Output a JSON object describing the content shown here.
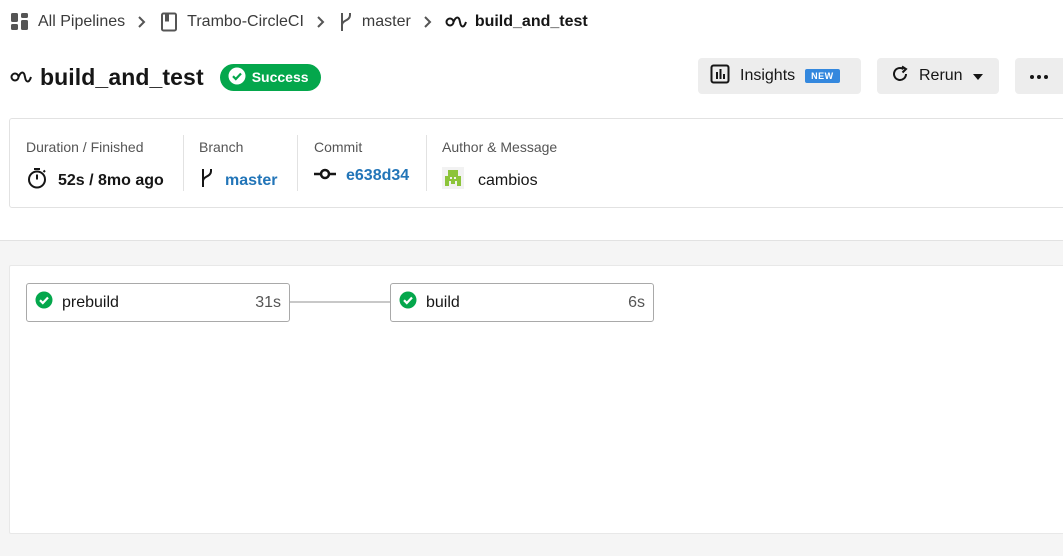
{
  "breadcrumb": {
    "all_pipelines": "All Pipelines",
    "project": "Trambo-CircleCI",
    "branch": "master",
    "workflow": "build_and_test"
  },
  "header": {
    "title": "build_and_test",
    "status": "Success",
    "insights_label": "Insights",
    "insights_badge": "NEW",
    "rerun_label": "Rerun"
  },
  "info": {
    "duration_label": "Duration / Finished",
    "duration_value": "52s / 8mo ago",
    "branch_label": "Branch",
    "branch_value": "master",
    "commit_label": "Commit",
    "commit_value": "e638d34",
    "author_label": "Author & Message",
    "author_value": "cambios"
  },
  "jobs": [
    {
      "name": "prebuild",
      "duration": "31s",
      "status": "success"
    },
    {
      "name": "build",
      "duration": "6s",
      "status": "success"
    }
  ],
  "colors": {
    "success": "#04a74c",
    "link": "#2275b8",
    "new_badge": "#3488de",
    "avatar": "#8cc43a"
  },
  "icons": {
    "pipelines": "grid-icon",
    "project": "book-icon",
    "branch": "branch-icon",
    "workflow": "workflow-icon",
    "duration": "stopwatch-icon",
    "commit": "commit-icon",
    "insights": "bar-chart-icon",
    "rerun": "rerun-icon",
    "more": "more-icon"
  }
}
